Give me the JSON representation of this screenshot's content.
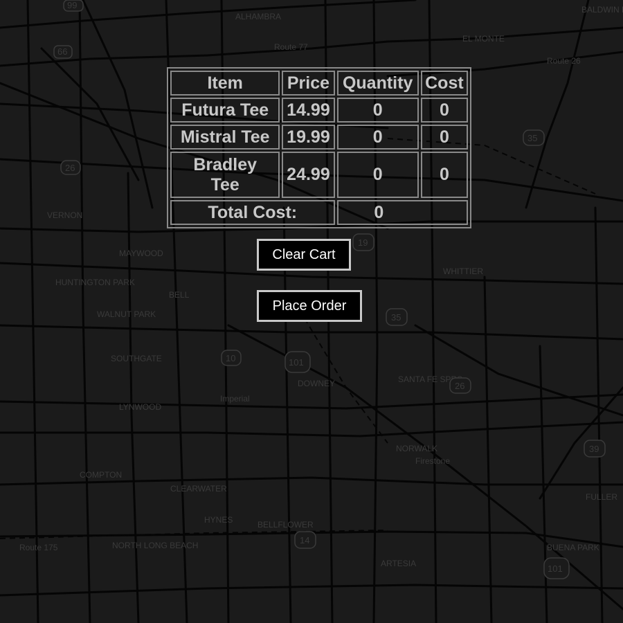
{
  "cart": {
    "headers": [
      "Item",
      "Price",
      "Quantity",
      "Cost"
    ],
    "rows": [
      {
        "item": "Futura Tee",
        "price": "14.99",
        "quantity": "0",
        "cost": "0"
      },
      {
        "item": "Mistral Tee",
        "price": "19.99",
        "quantity": "0",
        "cost": "0"
      },
      {
        "item": "Bradley Tee",
        "price": "24.99",
        "quantity": "0",
        "cost": "0"
      }
    ],
    "total_label": "Total Cost:",
    "total_value": "0"
  },
  "buttons": {
    "clear_label": "Clear Cart",
    "order_label": "Place Order"
  },
  "map_labels": {
    "alhambra": "ALHAMBRA",
    "el_monte": "EL MONTE",
    "baldwin_park": "BALDWIN PARK",
    "vernon": "VERNON",
    "maywood": "MAYWOOD",
    "huntington_park": "HUNTINGTON PARK",
    "bell": "BELL",
    "walnut_park": "WALNUT PARK",
    "southgate": "SOUTHGATE",
    "lynwood": "LYNWOOD",
    "downey": "DOWNEY",
    "santa_fe_sprs": "SANTA FE SPRS",
    "whittier": "WHITTIER",
    "norwalk": "NORWALK",
    "compton": "COMPTON",
    "clearwater": "CLEARWATER",
    "hynes": "HYNES",
    "bellflower": "BELLFLOWER",
    "artesia": "ARTESIA",
    "north_long_beach": "NORTH LONG BEACH",
    "buena_park": "BUENA PARK",
    "fullerton": "FULLER",
    "route_175": "Route 175",
    "route_26": "Route 26",
    "route_77": "Route 77",
    "firestone": "Firestone",
    "imperial": "Imperial",
    "shield_99": "99",
    "shield_66": "66",
    "shield_26": "26",
    "shield_35": "35",
    "shield_19": "19",
    "shield_10": "10",
    "shield_101": "101",
    "shield_14": "14",
    "shield_39": "39"
  },
  "colors": {
    "background": "#1b1b1b",
    "map_line": "#000000",
    "map_text": "#3a3a3a",
    "table_border": "#8a8a8a",
    "table_text": "#c8c8c8",
    "button_bg": "#000000",
    "button_text": "#ffffff",
    "button_border": "#c9c9c9"
  }
}
